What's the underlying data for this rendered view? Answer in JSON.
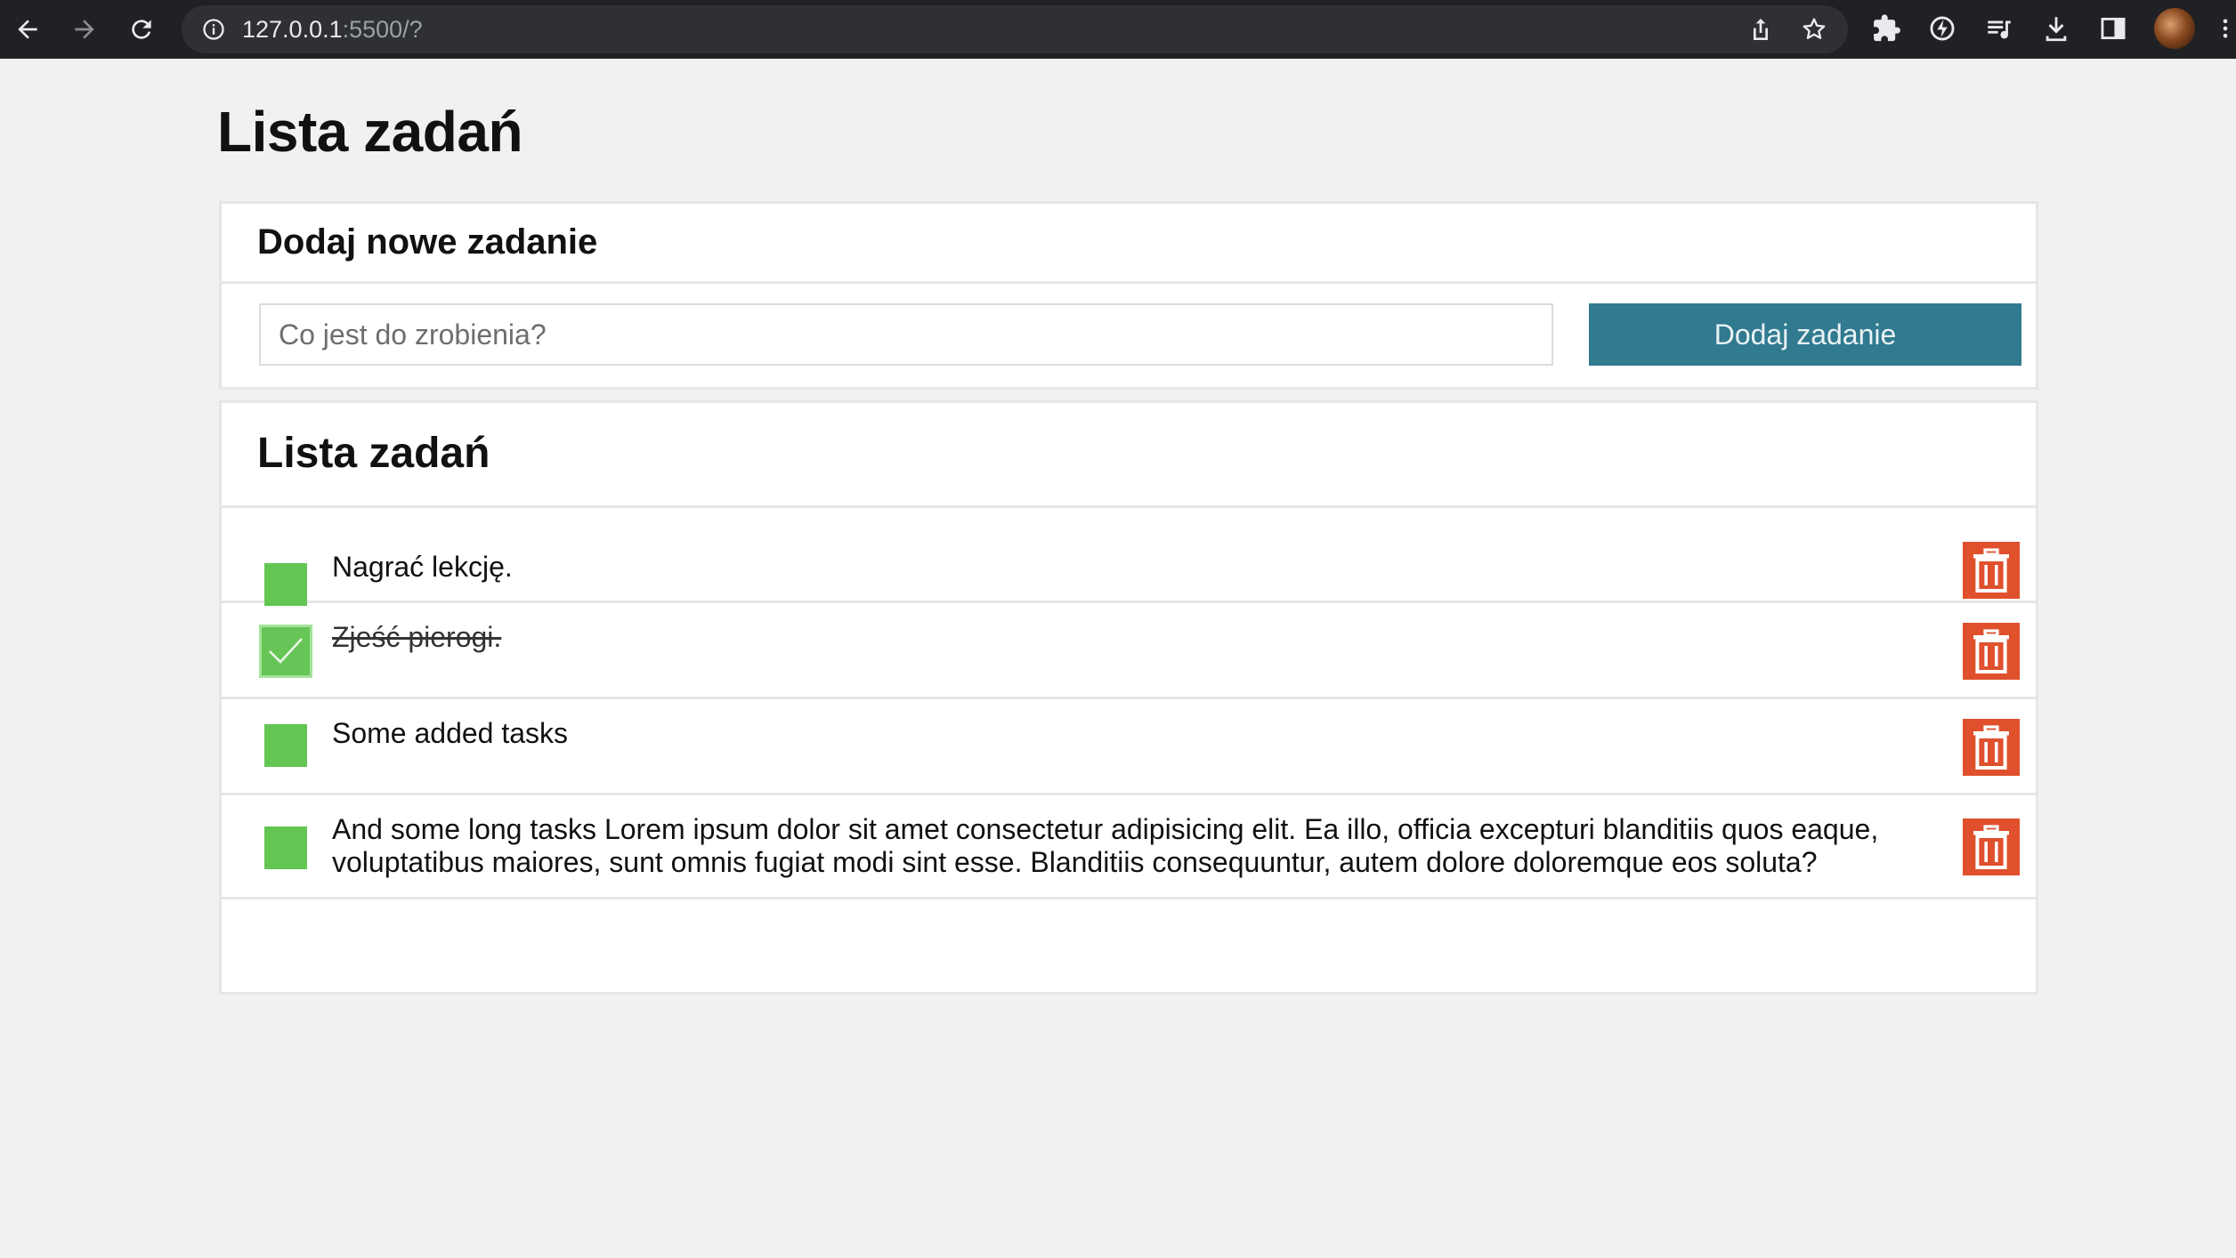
{
  "browser": {
    "url_host": "127.0.0.1",
    "url_rest": ":5500/?"
  },
  "page": {
    "title": "Lista zadań"
  },
  "add_card": {
    "heading": "Dodaj nowe zadanie",
    "input_placeholder": "Co jest do zrobienia?",
    "input_value": "",
    "button_label": "Dodaj zadanie"
  },
  "list_card": {
    "heading": "Lista zadań",
    "tasks": [
      {
        "text": "Nagrać lekcję.",
        "done": false
      },
      {
        "text": "Zjeść pierogi.",
        "done": true
      },
      {
        "text": "Some added tasks",
        "done": false
      },
      {
        "text": "And some long tasks Lorem ipsum dolor sit amet consectetur adipisicing elit. Ea illo, officia excepturi blanditiis quos eaque, voluptatibus maiores, sunt omnis fugiat modi sint esse. Blanditiis consequuntur, autem dolore doloremque eos soluta?",
        "done": false
      }
    ]
  },
  "colors": {
    "accent": "#317a8f",
    "check_green": "#63c653",
    "delete_red": "#e0502d",
    "background": "#f1f1f1"
  },
  "icons": {
    "toolbar": [
      "back-arrow-icon",
      "forward-arrow-icon",
      "reload-icon",
      "site-info-icon",
      "share-icon",
      "bookmark-star-icon",
      "extensions-puzzle-icon",
      "performance-icon",
      "reading-list-icon",
      "download-icon",
      "side-panel-icon",
      "profile-avatar",
      "menu-kebab-icon"
    ],
    "task": [
      "checkbox-icon",
      "checkmark-icon",
      "trash-icon"
    ]
  }
}
